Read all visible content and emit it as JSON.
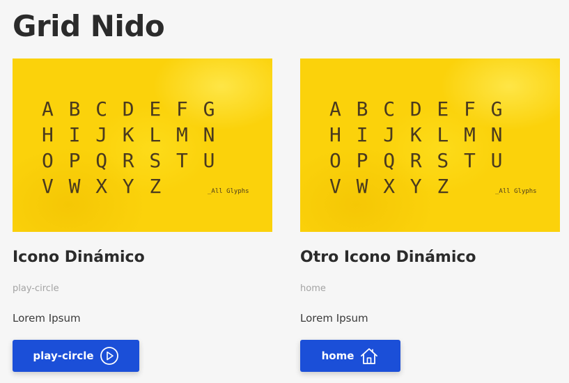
{
  "page": {
    "title": "Grid Nido"
  },
  "glyph_image": {
    "rows": [
      [
        "A",
        "B",
        "C",
        "D",
        "E",
        "F",
        "G"
      ],
      [
        "H",
        "I",
        "J",
        "K",
        "L",
        "M",
        "N"
      ],
      [
        "O",
        "P",
        "Q",
        "R",
        "S",
        "T",
        "U"
      ],
      [
        "V",
        "W",
        "X",
        "Y",
        "Z"
      ]
    ],
    "caption": "_All Glyphs"
  },
  "cards": [
    {
      "title": "Icono Dinámico",
      "icon_name": "play-circle",
      "text": "Lorem Ipsum",
      "button_label": "play-circle",
      "button_icon": "play-circle-icon"
    },
    {
      "title": "Otro Icono Dinámico",
      "icon_name": "home",
      "text": "Lorem Ipsum",
      "button_label": "home",
      "button_icon": "home-icon"
    }
  ],
  "colors": {
    "background": "#f6f6f6",
    "hero_yellow": "#fbd20b",
    "button_blue": "#1b4fd8",
    "title_text": "#2b2b2b",
    "muted_text": "#a3a3a3"
  }
}
